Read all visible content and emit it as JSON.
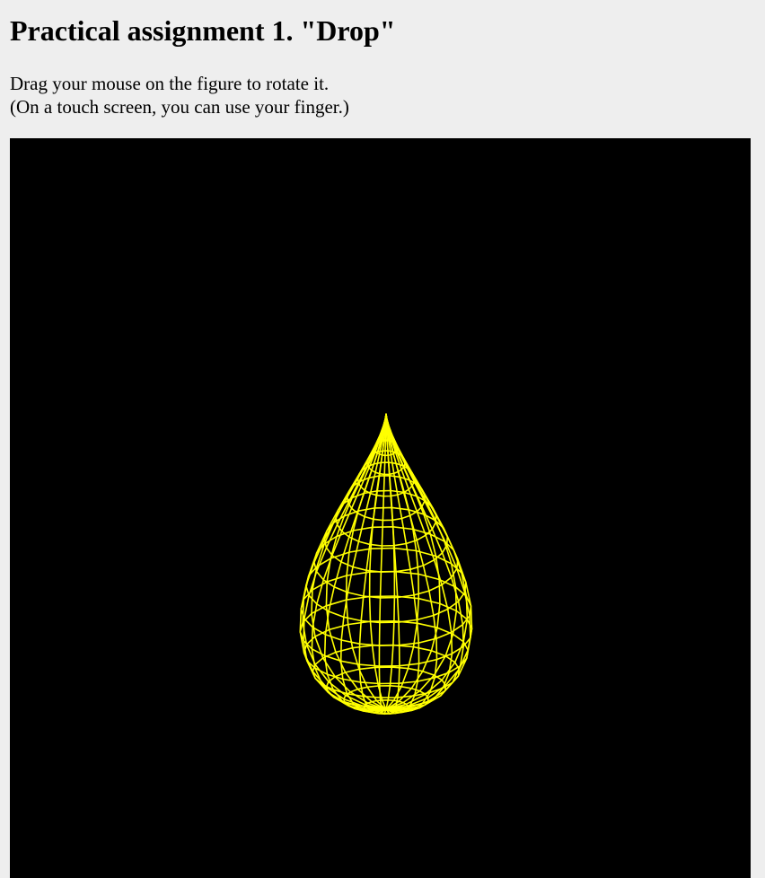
{
  "page": {
    "title": "Practical assignment 1. \"Drop\"",
    "instructions": [
      "Drag your mouse on the figure to rotate it.",
      "(On a touch screen, you can use your finger.)"
    ]
  },
  "viewer": {
    "background_color": "#000000",
    "wireframe_color": "#ffff00",
    "figure": "drop"
  }
}
